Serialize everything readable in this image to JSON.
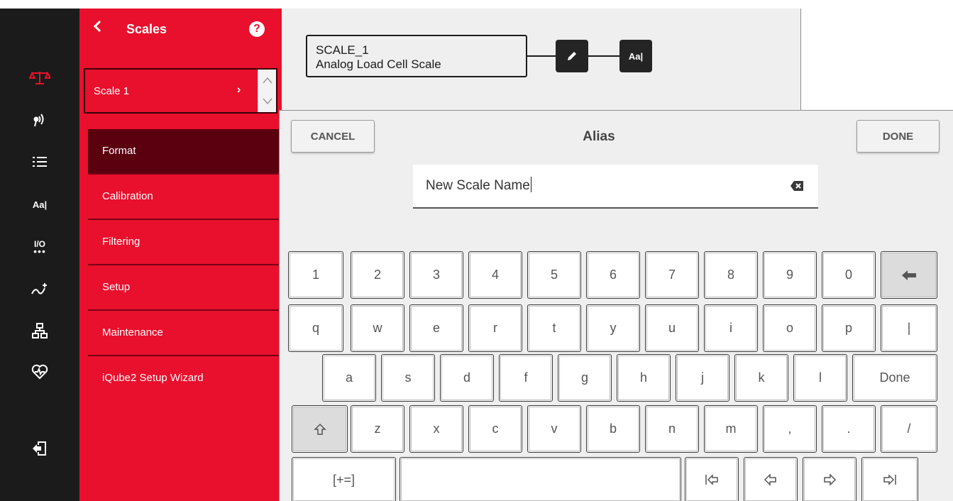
{
  "colors": {
    "accent": "#e8102d",
    "accent_dark": "#5a000f",
    "rail_bg": "#1b1b1b",
    "panel_bg": "#efefef"
  },
  "rail": {
    "items": [
      {
        "name": "scale-icon",
        "active": true
      },
      {
        "name": "wireless-icon"
      },
      {
        "name": "list-icon"
      },
      {
        "name": "text-alias-icon",
        "text": "Aa|"
      },
      {
        "name": "io-icon",
        "text": "I/O"
      },
      {
        "name": "math-function-icon"
      },
      {
        "name": "network-icon"
      },
      {
        "name": "diagnostics-icon"
      },
      {
        "name": "logout-icon"
      }
    ]
  },
  "menu": {
    "title": "Scales",
    "selected_scale": "Scale 1",
    "items": [
      {
        "label": "Format",
        "active": true
      },
      {
        "label": "Calibration"
      },
      {
        "label": "Filtering"
      },
      {
        "label": "Setup"
      },
      {
        "label": "Maintenance"
      },
      {
        "label": "iQube2 Setup Wizard"
      }
    ]
  },
  "main": {
    "card": {
      "id": "SCALE_1",
      "type": "Analog Load Cell Scale"
    },
    "alias_node_label": "Aa|"
  },
  "dialog": {
    "title": "Alias",
    "cancel_label": "CANCEL",
    "done_label": "DONE",
    "input_value": "New Scale Name",
    "keyboard": {
      "row1": [
        "1",
        "2",
        "3",
        "4",
        "5",
        "6",
        "7",
        "8",
        "9",
        "0"
      ],
      "row2": [
        "q",
        "w",
        "e",
        "r",
        "t",
        "y",
        "u",
        "i",
        "o",
        "p",
        "|"
      ],
      "row3": [
        "a",
        "s",
        "d",
        "f",
        "g",
        "h",
        "j",
        "k",
        "l",
        "Done"
      ],
      "row4": [
        "z",
        "x",
        "c",
        "v",
        "b",
        "n",
        "m",
        ",",
        ".",
        "/"
      ],
      "symbols_label": "[+=]"
    }
  }
}
